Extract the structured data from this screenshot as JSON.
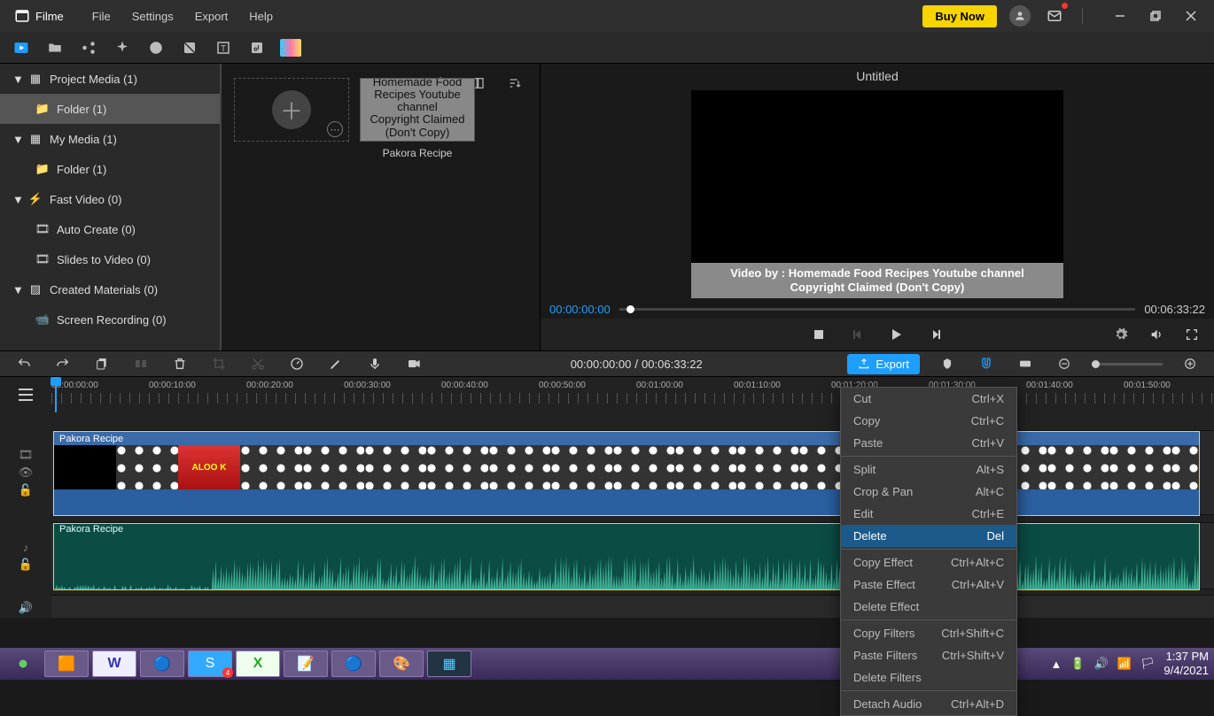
{
  "app": {
    "name": "Filme"
  },
  "menu": [
    "File",
    "Settings",
    "Export",
    "Help"
  ],
  "titlebar": {
    "buy": "Buy Now"
  },
  "sidebar": {
    "items": [
      {
        "label": "Project Media (1)",
        "type": "head"
      },
      {
        "label": "Folder (1)",
        "type": "child",
        "selected": true
      },
      {
        "label": "My Media (1)",
        "type": "head"
      },
      {
        "label": "Folder (1)",
        "type": "child"
      },
      {
        "label": "Fast Video (0)",
        "type": "head"
      },
      {
        "label": "Auto Create (0)",
        "type": "child"
      },
      {
        "label": "Slides to Video (0)",
        "type": "child"
      },
      {
        "label": "Created Materials (0)",
        "type": "head"
      },
      {
        "label": "Screen Recording (0)",
        "type": "child"
      }
    ]
  },
  "media": {
    "clip_name": "Pakora Recipe",
    "thumb_caption_line1": "Video by: Homemade Food Recipes Youtube channel",
    "thumb_caption_line2": "Copyright Claimed (Don't Copy)"
  },
  "preview": {
    "title": "Untitled",
    "overlay_line1": "Video by : Homemade Food Recipes Youtube channel",
    "overlay_line2": "Copyright Claimed (Don't Copy)",
    "time_current": "00:00:00:00",
    "time_total": "00:06:33:22"
  },
  "timeline": {
    "pos": "00:00:00:00",
    "dur": "00:06:33:22",
    "export": "Export",
    "ticks": [
      "00:00:00:00",
      "00:00:10:00",
      "00:00:20:00",
      "00:00:30:00",
      "00:00:40:00",
      "00:00:50:00",
      "00:01:00:00",
      "00:01:10:00",
      "00:01:20:00",
      "00:01:30:00",
      "00:01:40:00",
      "00:01:50:00"
    ],
    "video_clip": "Pakora Recipe",
    "audio_clip": "Pakora Recipe"
  },
  "context_menu": {
    "groups": [
      [
        {
          "label": "Cut",
          "sc": "Ctrl+X"
        },
        {
          "label": "Copy",
          "sc": "Ctrl+C"
        },
        {
          "label": "Paste",
          "sc": "Ctrl+V"
        }
      ],
      [
        {
          "label": "Split",
          "sc": "Alt+S"
        },
        {
          "label": "Crop & Pan",
          "sc": "Alt+C"
        },
        {
          "label": "Edit",
          "sc": "Ctrl+E"
        },
        {
          "label": "Delete",
          "sc": "Del",
          "hl": true
        }
      ],
      [
        {
          "label": "Copy Effect",
          "sc": "Ctrl+Alt+C"
        },
        {
          "label": "Paste Effect",
          "sc": "Ctrl+Alt+V"
        },
        {
          "label": "Delete Effect",
          "sc": ""
        }
      ],
      [
        {
          "label": "Copy Filters",
          "sc": "Ctrl+Shift+C"
        },
        {
          "label": "Paste Filters",
          "sc": "Ctrl+Shift+V"
        },
        {
          "label": "Delete Filters",
          "sc": ""
        }
      ],
      [
        {
          "label": "Detach Audio",
          "sc": "Ctrl+Alt+D"
        }
      ]
    ]
  },
  "taskbar": {
    "time": "1:37 PM",
    "date": "9/4/2021"
  }
}
